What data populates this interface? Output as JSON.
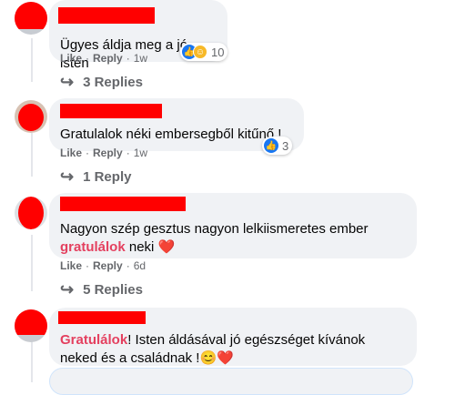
{
  "comments": [
    {
      "text": "Ügyes áldja meg a jó isten",
      "like_label": "Like",
      "reply_label": "Reply",
      "time": "1w",
      "reaction_count": "10",
      "replies_label": "3 Replies"
    },
    {
      "text": "Gratulalok néki embersegből kitűnő !",
      "like_label": "Like",
      "reply_label": "Reply",
      "time": "1w",
      "reaction_count": "3",
      "replies_label": "1 Reply"
    },
    {
      "text_before": "Nagyon szép gesztus nagyon lelkiismeretes ember",
      "brand_word": "gratulálok",
      "text_after": "neki",
      "like_label": "Like",
      "reply_label": "Reply",
      "time": "6d",
      "replies_label": "5 Replies"
    },
    {
      "brand_word": "Gratulálok",
      "text_after": "! Isten áldásával jó egészséget kívánok neked és a családnak !"
    }
  ],
  "colors": {
    "redaction": "#ff0000",
    "bubble_bg": "#f0f2f5",
    "meta_text": "#65676b",
    "brand_pink": "#e4405f",
    "like_blue": "#1877f2"
  },
  "icons": {
    "reply_arrow": "reply-arrow-icon",
    "like": "like-icon",
    "care": "care-icon",
    "heart": "heart-icon",
    "smile": "smiling-face-icon"
  }
}
